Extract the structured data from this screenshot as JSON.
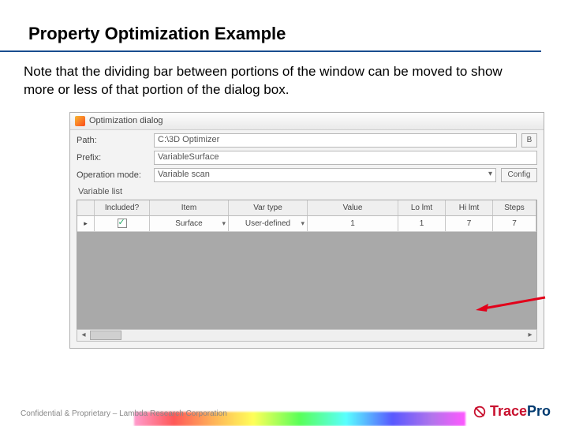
{
  "slide": {
    "title": "Property Optimization Example",
    "note": "Note that the dividing bar between portions of the window can be moved to show more or less of that portion of the dialog box."
  },
  "dialog": {
    "title": "Optimization dialog",
    "path_label": "Path:",
    "path_value": "C:\\3D Optimizer",
    "browse_btn": "B",
    "prefix_label": "Prefix:",
    "prefix_value": "VariableSurface",
    "opmode_label": "Operation mode:",
    "opmode_value": "Variable scan",
    "config_btn": "Config",
    "tab_label": "Variable list",
    "columns": {
      "included": "Included?",
      "item": "Item",
      "vartype": "Var type",
      "value": "Value",
      "lolmt": "Lo lmt",
      "hilmt": "Hi lmt",
      "steps": "Steps"
    },
    "row": {
      "item": "Surface",
      "vartype": "User-defined",
      "value": "1",
      "lolmt": "1",
      "hilmt": "7",
      "steps": "7"
    }
  },
  "footer": {
    "confidential": "Confidential & Proprietary – Lambda Research Corporation",
    "brand1": "Trace",
    "brand2": "Pro"
  }
}
